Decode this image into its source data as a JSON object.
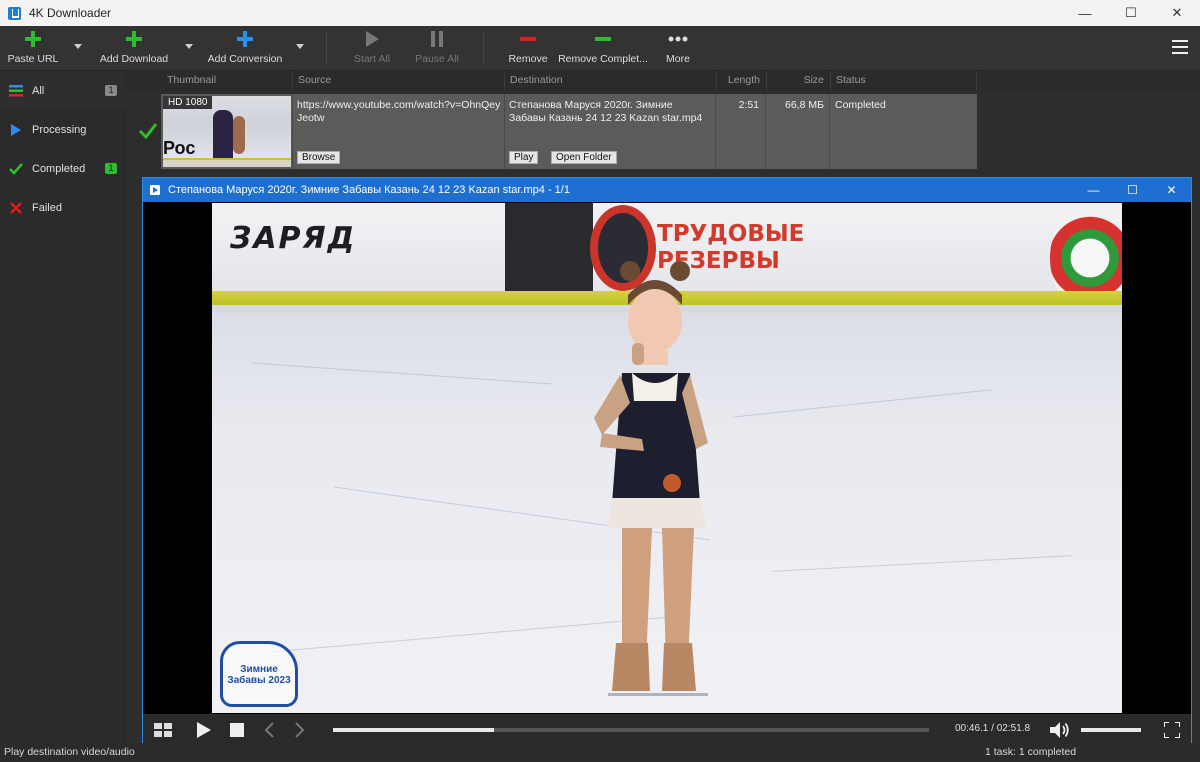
{
  "app": {
    "title": "4K Downloader"
  },
  "window_controls": {
    "minimize": "—",
    "maximize": "☐",
    "close": "✕"
  },
  "toolbar": {
    "paste_url": "Paste URL",
    "add_download": "Add Download",
    "add_conversion": "Add Conversion",
    "start_all": "Start All",
    "pause_all": "Pause All",
    "remove": "Remove",
    "remove_completed": "Remove Complet...",
    "more": "More"
  },
  "colors": {
    "accent": "#1e6fd0",
    "green": "#2ebd2e",
    "red": "#e02020",
    "blue_plus": "#2a8ff0"
  },
  "sidebar": {
    "items": [
      {
        "label": "All",
        "count": "1",
        "icon": "list-icon"
      },
      {
        "label": "Processing",
        "icon": "play-icon"
      },
      {
        "label": "Completed",
        "count": "1",
        "icon": "check-icon"
      },
      {
        "label": "Failed",
        "icon": "x-icon"
      }
    ]
  },
  "table": {
    "headers": {
      "thumbnail": "Thumbnail",
      "source": "Source",
      "destination": "Destination",
      "length": "Length",
      "size": "Size",
      "status": "Status"
    },
    "rows": [
      {
        "quality": "HD 1080",
        "thumb_text": "Рос",
        "source": "https://www.youtube.com/watch?v=OhnQeyJeotw",
        "destination": "Степанова Маруся 2020г.  Зимние Забавы Казань 24 12 23 Kazan star.mp4",
        "length": "2:51",
        "size": "66,8 МБ",
        "status": "Completed",
        "browse": "Browse",
        "play": "Play",
        "open_folder": "Open Folder"
      }
    ]
  },
  "player": {
    "title": "Степанова Маруся 2020г.  Зимние Забавы Казань 24 12 23 Kazan star.mp4 - 1/1",
    "time": "00:46.1 / 02:51.8",
    "progress_fraction": 0.27,
    "volume_fraction": 1.0,
    "video": {
      "board_left": "ЗАРЯД",
      "board_right": "ТРУДОВЫЕ РЕЗЕРВЫ",
      "logo_text": "Зимние Забавы 2023"
    }
  },
  "status": {
    "left": "Play destination video/audio",
    "right": "1 task: 1 completed"
  }
}
